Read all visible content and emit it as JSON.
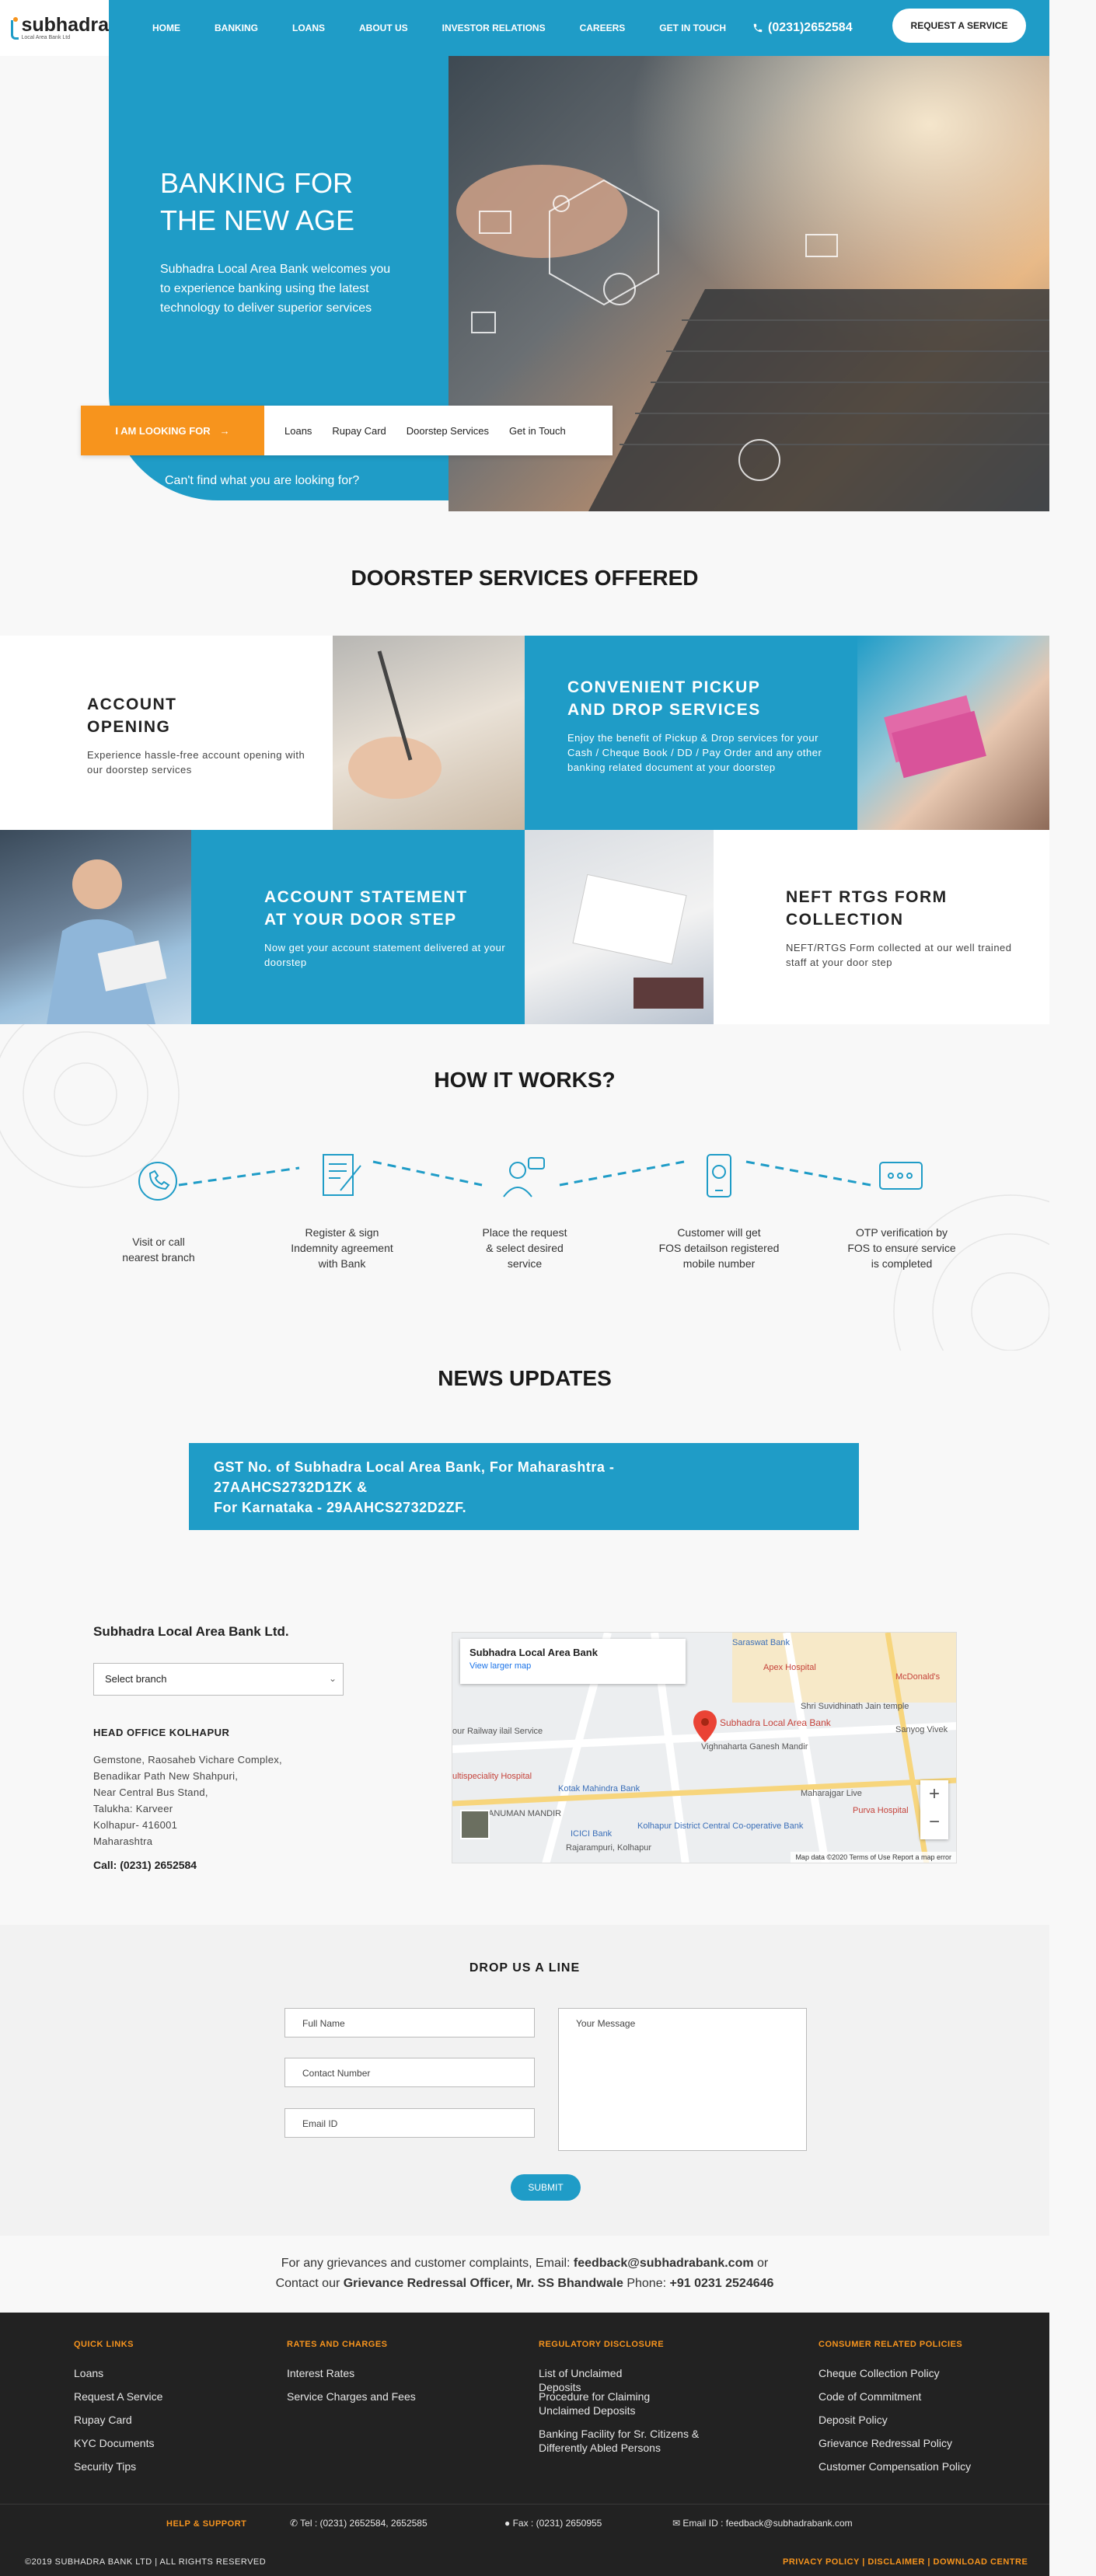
{
  "header": {
    "logo_name": "subhadra",
    "logo_sub": "Local Area Bank Ltd",
    "nav": [
      "HOME",
      "BANKING",
      "LOANS",
      "ABOUT US",
      "INVESTOR RELATIONS",
      "CAREERS",
      "GET IN TOUCH"
    ],
    "phone": "(0231)2652584",
    "request_button": "REQUEST A SERVICE"
  },
  "hero": {
    "title_line1": "BANKING FOR",
    "title_line2": "THE NEW AGE",
    "text": "Subhadra Local Area Bank welcomes you to experience banking using the latest technology to deliver superior services",
    "looking_button": "I AM LOOKING FOR",
    "looking_items": [
      "Loans",
      "Rupay Card",
      "Doorstep Services",
      "Get in Touch"
    ],
    "cant_find": "Can't find what you are looking for?"
  },
  "doorstep": {
    "title": "DOORSTEP SERVICES OFFERED",
    "cards": [
      {
        "title_line1": "ACCOUNT",
        "title_line2": "OPENING",
        "text": "Experience hassle-free account opening with our doorstep services"
      },
      {
        "title_line1": "CONVENIENT PICKUP",
        "title_line2": "AND DROP SERVICES",
        "text": "Enjoy the benefit of Pickup & Drop services for your Cash / Cheque Book / DD / Pay Order and any other banking related document at your doorstep"
      },
      {
        "title_line1": "ACCOUNT STATEMENT",
        "title_line2": "AT YOUR DOOR STEP",
        "text": "Now get your account statement delivered at your doorstep"
      },
      {
        "title_line1": "NEFT RTGS FORM",
        "title_line2": "COLLECTION",
        "text": "NEFT/RTGS Form collected at our well trained staff at your door step"
      }
    ]
  },
  "how": {
    "title": "HOW IT WORKS?",
    "steps": [
      {
        "l1": "Visit or call",
        "l2": "nearest branch",
        "l3": ""
      },
      {
        "l1": "Register & sign",
        "l2": "Indemnity agreement",
        "l3": "with Bank"
      },
      {
        "l1": "Place the request",
        "l2": "& select desired",
        "l3": "service"
      },
      {
        "l1": "Customer will get",
        "l2": "FOS detailson registered",
        "l3": "mobile number"
      },
      {
        "l1": "OTP verification by",
        "l2": "FOS to ensure service",
        "l3": "is completed"
      }
    ]
  },
  "news": {
    "title": "NEWS UPDATES",
    "line1": "GST No. of Subhadra Local Area Bank, For Maharashtra -",
    "line2": "27AAHCS2732D1ZK &",
    "line3": "For Karnataka - 29AAHCS2732D2ZF."
  },
  "contact": {
    "bank_name": "Subhadra Local Area Bank Ltd.",
    "branch_select": "Select branch",
    "head_office": "HEAD OFFICE KOLHAPUR",
    "address": [
      "Gemstone, Raosaheb Vichare Complex,",
      "Benadikar Path New Shahpuri,",
      "Near Central Bus Stand,",
      "Talukha: Karveer",
      "Kolhapur- 416001",
      "Maharashtra"
    ],
    "call": "Call: (0231) 2652584",
    "map": {
      "card_title": "Subhadra Local Area Bank",
      "card_link": "View larger map",
      "pin_label": "Subhadra Local Area Bank",
      "labels": [
        "Saraswat Bank",
        "Apex Hospital",
        "McDonald's",
        "Shri Suvidhinath Jain temple",
        "Sanyog Vivek",
        "Vighnaharta Ganesh Mandir",
        "Kotak Mahindra Bank",
        "Maharajgar Live",
        "Purva Hospital",
        "Kolhapur District Central Co-operative Bank",
        "ICICI Bank",
        "Rajarampuri, Kolhapur",
        "ultispeciality Hospital",
        "ANUMAN MANDIR",
        "our Railway ilail Service"
      ],
      "footer": "Map data ©2020   Terms of Use   Report a map error",
      "zoom_in": "+",
      "zoom_out": "−"
    }
  },
  "drop": {
    "title": "DROP US A LINE",
    "full_name": "Full Name",
    "contact": "Contact Number",
    "email": "Email ID",
    "message": "Your Message",
    "submit": "SUBMIT"
  },
  "grievance": {
    "pre": "For any grievances and customer complaints, Email: ",
    "email": "feedback@subhadrabank.com",
    "or": " or",
    "pre2": "Contact our ",
    "officer": "Grievance Redressal Officer, Mr. SS Bhandwale",
    "phone_pre": " Phone: ",
    "phone": "+91 0231 2524646"
  },
  "footer": {
    "cols": [
      {
        "head": "QUICK LINKS",
        "links": [
          "Loans",
          "Request A Service",
          "Rupay Card",
          "KYC Documents",
          "Security Tips"
        ]
      },
      {
        "head": "RATES AND CHARGES",
        "links": [
          "Interest Rates",
          "Service Charges and Fees"
        ]
      },
      {
        "head": "REGULATORY DISCLOSURE",
        "links": [
          "List of Unclaimed Deposits",
          "Procedure for Claiming Unclaimed Deposits",
          "Banking Facility for Sr. Citizens & Differently Abled Persons"
        ]
      },
      {
        "head": "CONSUMER RELATED POLICIES",
        "links": [
          "Cheque Collection Policy",
          "Code of Commitment",
          "Deposit Policy",
          "Grievance Redressal Policy",
          "Customer Compensation Policy"
        ]
      }
    ],
    "help_head": "HELP & SUPPORT",
    "tel": "Tel : (0231) 2652584, 2652585",
    "fax": "Fax : (0231) 2650955",
    "email": "Email ID : feedback@subhadrabank.com",
    "copyright": "©2019 SUBHADRA BANK LTD | ALL RIGHTS RESERVED",
    "policy_links": "PRIVACY POLICY | DISCLAIMER | DOWNLOAD CENTRE"
  },
  "colors": {
    "brand": "#1f9cc7",
    "accent": "#f7941d",
    "footer": "#222222"
  }
}
